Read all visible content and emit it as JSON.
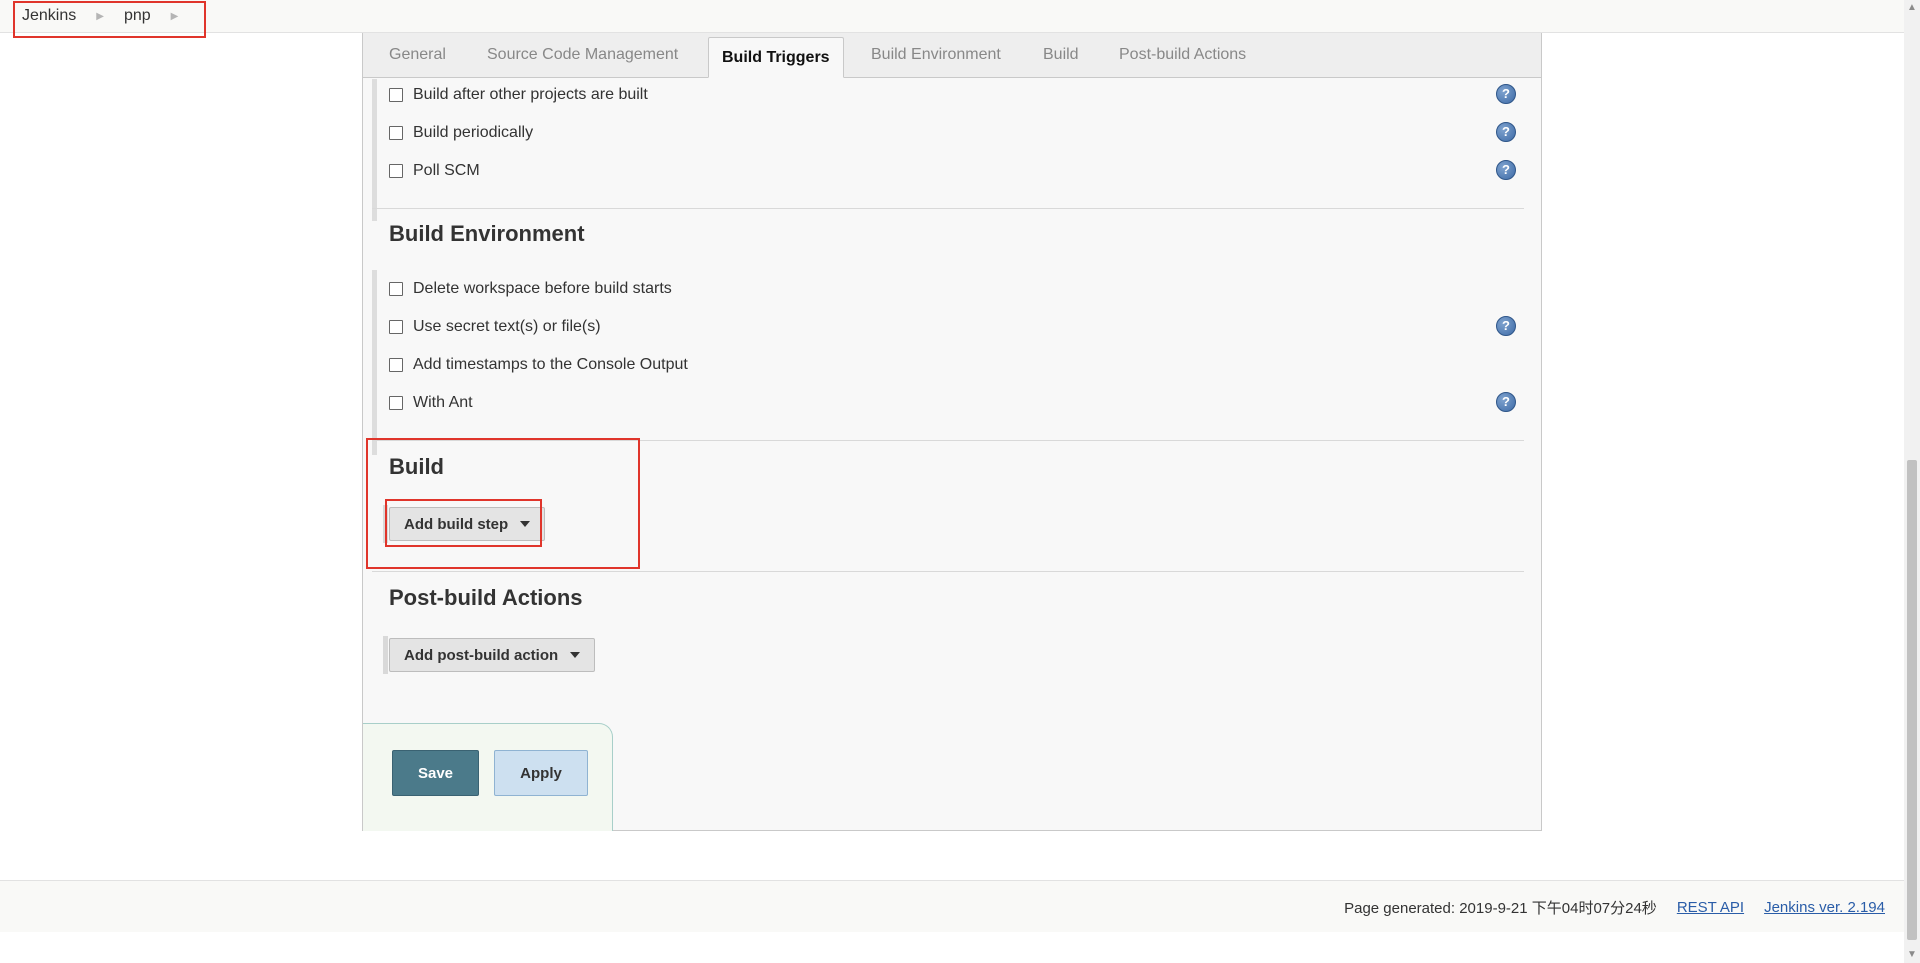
{
  "breadcrumb": {
    "items": [
      "Jenkins",
      "pnp"
    ]
  },
  "tabs": [
    {
      "label": "General",
      "active": false
    },
    {
      "label": "Source Code Management",
      "active": false
    },
    {
      "label": "Build Triggers",
      "active": true
    },
    {
      "label": "Build Environment",
      "active": false
    },
    {
      "label": "Build",
      "active": false
    },
    {
      "label": "Post-build Actions",
      "active": false
    }
  ],
  "build_triggers": {
    "options": [
      {
        "label": "Build after other projects are built",
        "checked": false,
        "help": true
      },
      {
        "label": "Build periodically",
        "checked": false,
        "help": true
      },
      {
        "label": "Poll SCM",
        "checked": false,
        "help": true
      }
    ]
  },
  "build_environment": {
    "title": "Build Environment",
    "options": [
      {
        "label": "Delete workspace before build starts",
        "checked": false,
        "help": false
      },
      {
        "label": "Use secret text(s) or file(s)",
        "checked": false,
        "help": true
      },
      {
        "label": "Add timestamps to the Console Output",
        "checked": false,
        "help": false
      },
      {
        "label": "With Ant",
        "checked": false,
        "help": true
      }
    ]
  },
  "build": {
    "title": "Build",
    "add_step_label": "Add build step"
  },
  "post_build": {
    "title": "Post-build Actions",
    "add_action_label": "Add post-build action"
  },
  "actions": {
    "save_label": "Save",
    "apply_label": "Apply"
  },
  "footer": {
    "generated": "Page generated: 2019-9-21 下午04时07分24秒",
    "rest_api": "REST API",
    "version": "Jenkins ver. 2.194"
  },
  "help_icon": "question-mark-circle-icon",
  "colors": {
    "highlight": "#e0352b",
    "save_button": "#4b7a8a",
    "apply_button": "#cde0f0",
    "link": "#2a5da8"
  }
}
